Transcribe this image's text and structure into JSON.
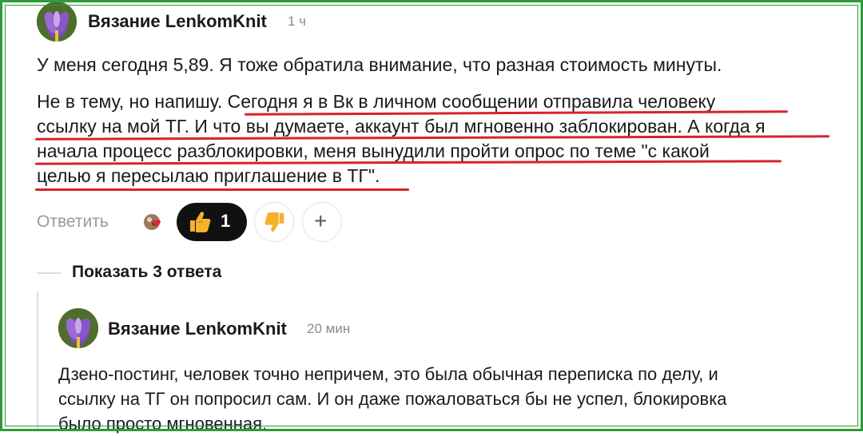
{
  "comment": {
    "author": "Вязание LenkomKnit",
    "time": "1 ч",
    "paragraph1": "У меня сегодня 5,89. Я тоже обратила внимание, что разная стоимость минуты.",
    "paragraph2_lines": [
      "Не в тему, но напишу. Сегодня я в Вк в личном сообщении отправила человеку",
      "ссылку на мой ТГ. И что вы думаете, аккаунт был мгновенно заблокирован. А когда я",
      "начала процесс разблокировки, меня вынудили пройти опрос по теме \"с какой",
      "целью я пересылаю приглашение в ТГ\"."
    ]
  },
  "actions": {
    "reply_label": "Ответить",
    "like_count": "1",
    "like_icon": "thumbs-up-icon",
    "dislike_icon": "thumbs-down-icon",
    "add_reaction_icon": "plus-icon",
    "add_reaction_symbol": "+"
  },
  "thread": {
    "show_replies_label": "Показать 3 ответа"
  },
  "reply": {
    "author": "Вязание LenkomKnit",
    "time": "20 мин",
    "lines": [
      "Дзено-постинг, человек точно непричем, это была обычная переписка по делу, и",
      "ссылку на ТГ он попросил сам. И он даже пожаловаться бы не успел, блокировка",
      "было просто мгновенная."
    ]
  },
  "colors": {
    "underline": "#d8232a",
    "frame": "#2e9b3a",
    "like_pill": "#111111"
  }
}
